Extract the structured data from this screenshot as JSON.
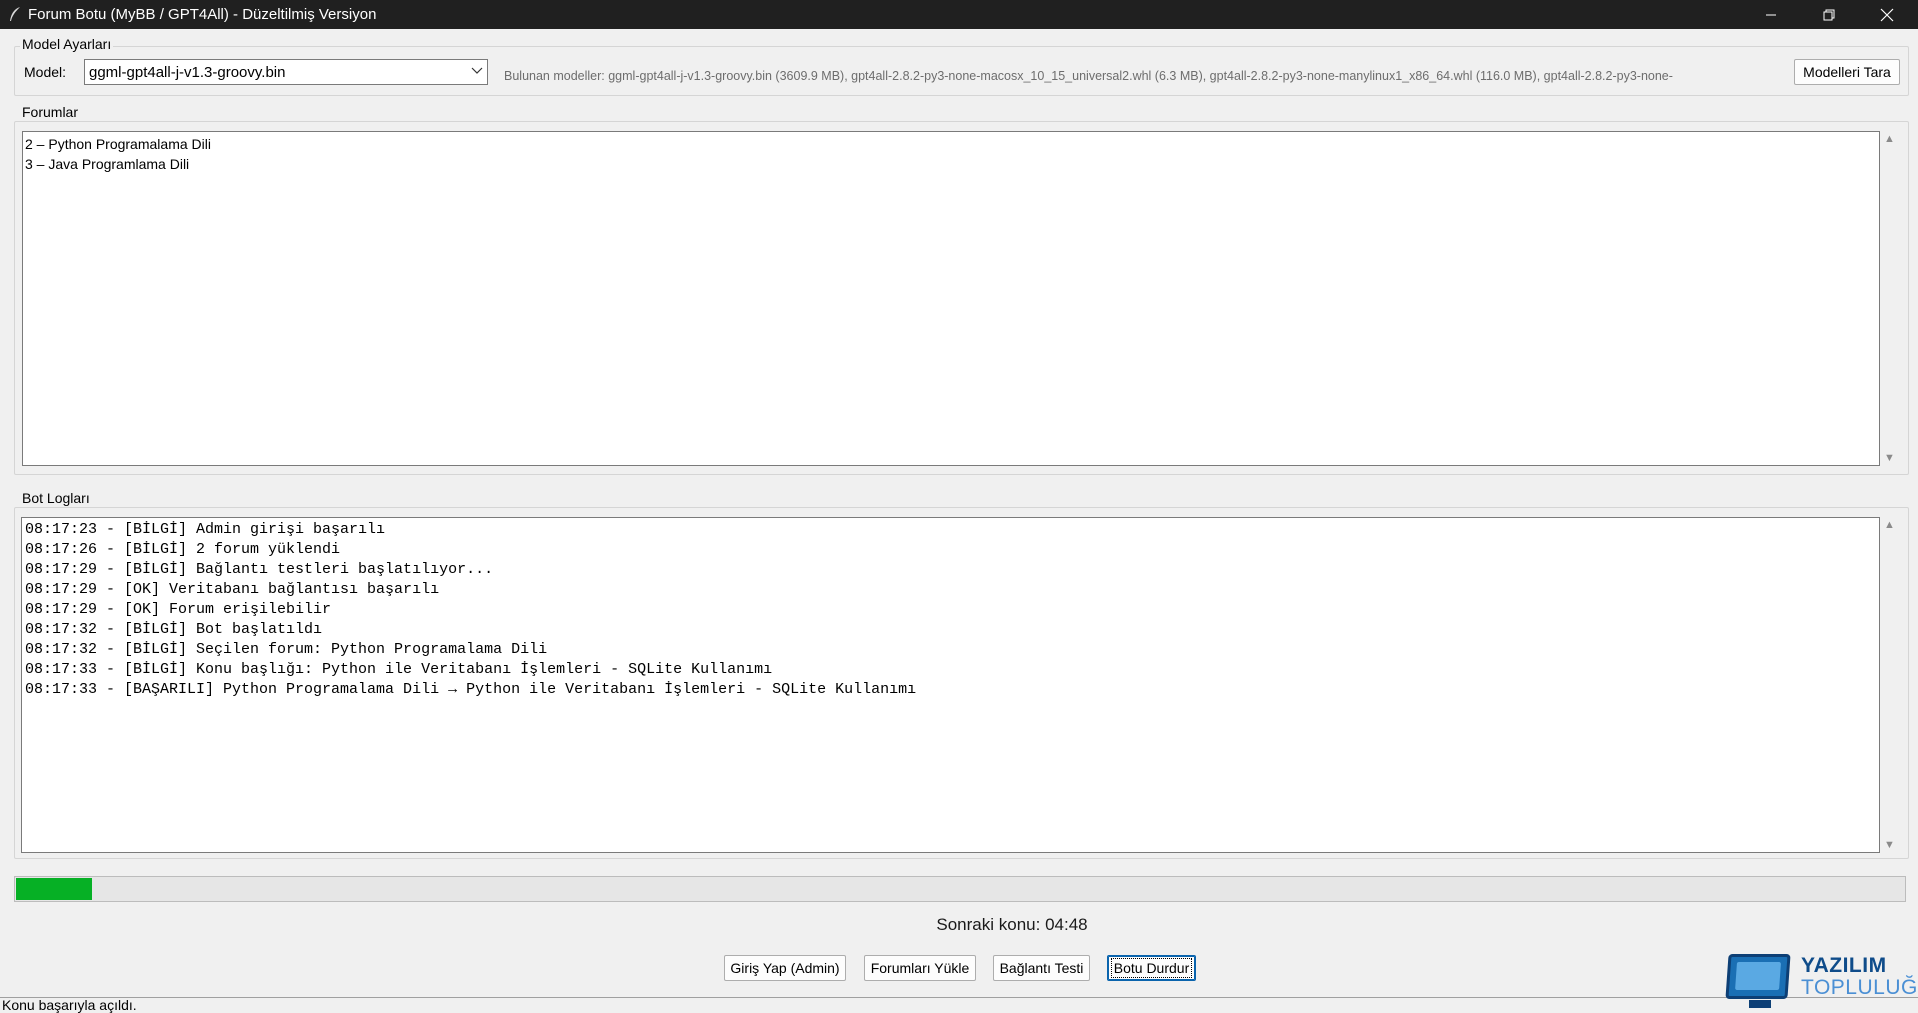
{
  "window": {
    "title": "Forum Botu (MyBB / GPT4All) - Düzeltilmiş Versiyon",
    "controls": {
      "minimize": "—",
      "restore": "❐",
      "close": "✕"
    }
  },
  "model_settings": {
    "group_label": "Model Ayarları",
    "model_label": "Model:",
    "selected_model": "ggml-gpt4all-j-v1.3-groovy.bin",
    "found_models": "Bulunan modeller: ggml-gpt4all-j-v1.3-groovy.bin (3609.9 MB), gpt4all-2.8.2-py3-none-macosx_10_15_universal2.whl (6.3 MB), gpt4all-2.8.2-py3-none-manylinux1_x86_64.whl (116.0 MB), gpt4all-2.8.2-py3-none-",
    "scan_button": "Modelleri Tara"
  },
  "forums": {
    "group_label": "Forumlar",
    "items": [
      "2 – Python Programalama Dili",
      "3 – Java Programlama Dili"
    ]
  },
  "logs": {
    "group_label": "Bot Logları",
    "lines": [
      "08:17:23 - [BİLGİ] Admin girişi başarılı",
      "08:17:26 - [BİLGİ] 2 forum yüklendi",
      "08:17:29 - [BİLGİ] Bağlantı testleri başlatılıyor...",
      "08:17:29 - [OK] Veritabanı bağlantısı başarılı",
      "08:17:29 - [OK] Forum erişilebilir",
      "08:17:32 - [BİLGİ] Bot başlatıldı",
      "08:17:32 - [BİLGİ] Seçilen forum: Python Programalama Dili",
      "08:17:33 - [BİLGİ] Konu başlığı: Python ile Veritabanı İşlemleri - SQLite Kullanımı",
      "08:17:33 - [BAŞARILI] Python Programalama Dili → Python ile Veritabanı İşlemleri - SQLite Kullanımı"
    ]
  },
  "progress": {
    "fraction": 0.04,
    "color": "#06b025"
  },
  "countdown": "Sonraki konu: 04:48",
  "actions": {
    "login": "Giriş Yap (Admin)",
    "load_forums": "Forumları Yükle",
    "connection_test": "Bağlantı Testi",
    "stop_bot": "Botu Durdur"
  },
  "status_bar": "Konu başarıyla açıldı.",
  "watermark": {
    "line1": "YAZILIM",
    "line2": "TOPLULUĞU"
  },
  "icons": {
    "app": "feather-icon",
    "dropdown": "chevron-down-icon",
    "scroll_up": "scroll-up-icon",
    "scroll_down": "scroll-down-icon",
    "logo": "monitor-icon"
  }
}
